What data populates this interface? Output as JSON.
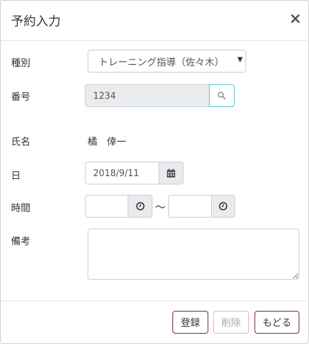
{
  "dialog": {
    "title": "予約入力",
    "close_glyph": "×"
  },
  "form": {
    "type_label": "種別",
    "type_value": "トレーニング指導（佐々木）",
    "number_label": "番号",
    "number_value": "1234",
    "name_label": "氏名",
    "name_value": "橘　倖一",
    "date_label": "日",
    "date_value": "2018/9/11",
    "time_label": "時間",
    "time_start": "",
    "time_end": "",
    "time_separator": "～",
    "remarks_label": "備考",
    "remarks_value": ""
  },
  "footer": {
    "register_label": "登録",
    "delete_label": "削除",
    "back_label": "もどる"
  },
  "colors": {
    "button_border": "#7a1e4a",
    "search_border": "#5bc0de",
    "disabled_bg": "#e9ecef"
  },
  "icons": {
    "search": "search-icon",
    "calendar": "calendar-icon",
    "clock": "clock-icon",
    "select_arrow": "caret-down-icon"
  }
}
